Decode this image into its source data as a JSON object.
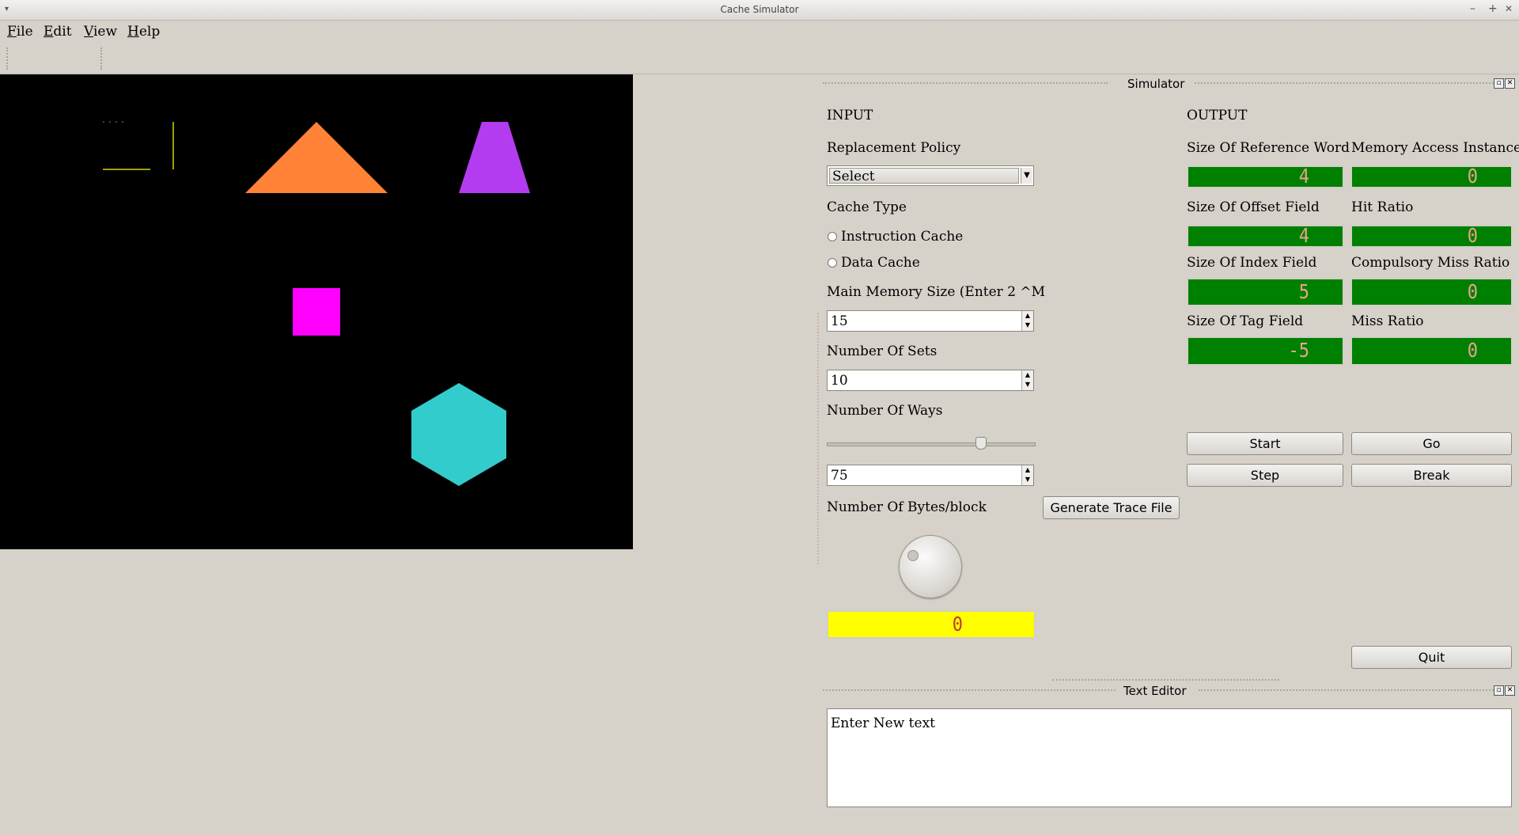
{
  "window": {
    "title": "Cache Simulator",
    "controls": [
      "–",
      "+",
      "✕"
    ],
    "menu_glyph": "▾"
  },
  "menu": [
    {
      "underline": "F",
      "rest": "ile"
    },
    {
      "underline": "E",
      "rest": "dit"
    },
    {
      "underline": "V",
      "rest": "iew"
    },
    {
      "underline": "H",
      "rest": "elp"
    }
  ],
  "canvas": {
    "shapes": [
      {
        "kind": "line-group",
        "color": "#d6d600"
      },
      {
        "kind": "triangle",
        "color": "#ff8237"
      },
      {
        "kind": "trapezoid",
        "color": "#b43cf0"
      },
      {
        "kind": "square",
        "color": "#ff00ff"
      },
      {
        "kind": "hexagon",
        "color": "#33cccc"
      }
    ]
  },
  "simulator": {
    "title": "Simulator",
    "input_heading": "INPUT",
    "output_heading": "OUTPUT",
    "replacement_policy": {
      "label": "Replacement Policy",
      "value": "Select"
    },
    "cache_type": {
      "label": "Cache Type",
      "options": [
        "Instruction Cache",
        "Data Cache"
      ]
    },
    "main_memory": {
      "label": "Main Memory Size (Enter 2 ^M",
      "value": "15"
    },
    "sets": {
      "label": "Number Of Sets",
      "value": "10"
    },
    "ways": {
      "label": "Number Of Ways",
      "slider_fraction": 0.75,
      "value": "75"
    },
    "bytes_per_block": {
      "label": "Number Of Bytes/block",
      "dial_value": 0,
      "display": "0"
    },
    "generate_button": "Generate Trace File",
    "outputs": [
      {
        "label": "Size Of Reference Word",
        "value": "4"
      },
      {
        "label": "Memory Access Instance",
        "value": "0"
      },
      {
        "label": "Size Of Offset Field",
        "value": "4"
      },
      {
        "label": "Hit Ratio",
        "value": "0"
      },
      {
        "label": "Size Of Index Field",
        "value": "5"
      },
      {
        "label": "Compulsory Miss Ratio",
        "value": "0"
      },
      {
        "label": "Size Of Tag Field",
        "value": "-5"
      },
      {
        "label": "Miss Ratio",
        "value": "0"
      }
    ],
    "buttons": {
      "start": "Start",
      "go": "Go",
      "step": "Step",
      "break": "Break",
      "quit": "Quit"
    },
    "lcd_color": "#008000",
    "yellow_lcd_color": "#ffff00"
  },
  "text_editor": {
    "title": "Text Editor",
    "content": "Enter New text"
  }
}
